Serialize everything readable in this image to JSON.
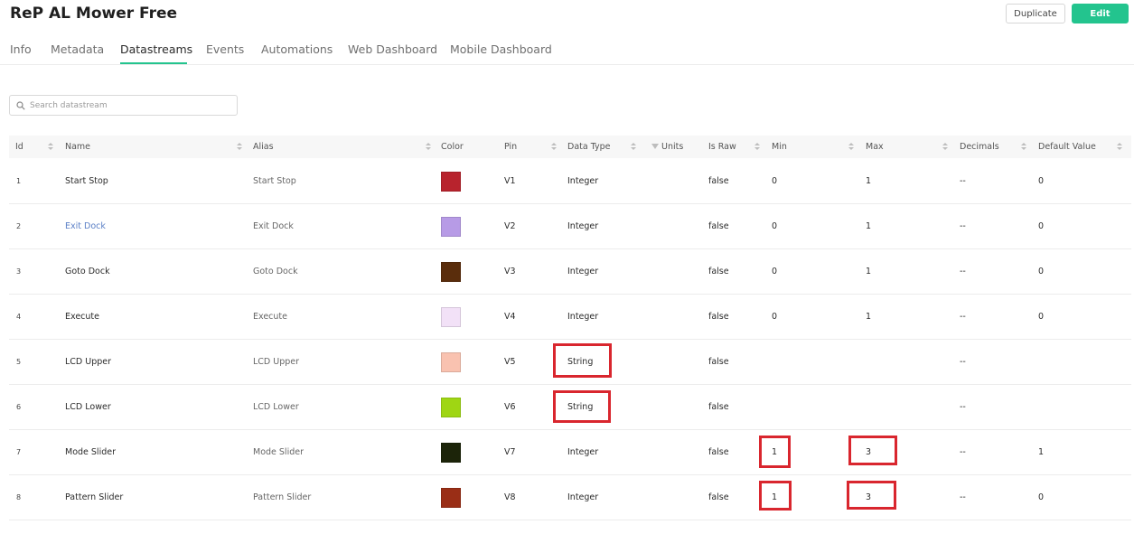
{
  "header": {
    "title": "ReP AL Mower Free",
    "duplicate_label": "Duplicate",
    "edit_label": "Edit"
  },
  "tabs": [
    "Info",
    "Metadata",
    "Datastreams",
    "Events",
    "Automations",
    "Web Dashboard",
    "Mobile Dashboard"
  ],
  "active_tab": "Datastreams",
  "search": {
    "placeholder": "Search datastream",
    "value": ""
  },
  "table": {
    "columns": [
      "Id",
      "Name",
      "Alias",
      "Color",
      "Pin",
      "Data Type",
      "Units",
      "Is Raw",
      "Min",
      "Max",
      "Decimals",
      "Default Value"
    ],
    "rows": [
      {
        "id": "1",
        "name": "Start Stop",
        "alias": "Start Stop",
        "color": "#b8232d",
        "pin": "V1",
        "data_type": "Integer",
        "units": "",
        "is_raw": "false",
        "min": "0",
        "max": "1",
        "decimals": "--",
        "default_value": "0"
      },
      {
        "id": "2",
        "name": "Exit Dock",
        "alias": "Exit Dock",
        "color": "#b79be6",
        "pin": "V2",
        "data_type": "Integer",
        "units": "",
        "is_raw": "false",
        "min": "0",
        "max": "1",
        "decimals": "--",
        "default_value": "0"
      },
      {
        "id": "3",
        "name": "Goto Dock",
        "alias": "Goto Dock",
        "color": "#5a2d0c",
        "pin": "V3",
        "data_type": "Integer",
        "units": "",
        "is_raw": "false",
        "min": "0",
        "max": "1",
        "decimals": "--",
        "default_value": "0"
      },
      {
        "id": "4",
        "name": "Execute",
        "alias": "Execute",
        "color": "#f2e1f7",
        "pin": "V4",
        "data_type": "Integer",
        "units": "",
        "is_raw": "false",
        "min": "0",
        "max": "1",
        "decimals": "--",
        "default_value": "0"
      },
      {
        "id": "5",
        "name": "LCD Upper",
        "alias": "LCD Upper",
        "color": "#f9c2b0",
        "pin": "V5",
        "data_type": "String",
        "units": "",
        "is_raw": "false",
        "min": "",
        "max": "",
        "decimals": "--",
        "default_value": ""
      },
      {
        "id": "6",
        "name": "LCD Lower",
        "alias": "LCD Lower",
        "color": "#9fd613",
        "pin": "V6",
        "data_type": "String",
        "units": "",
        "is_raw": "false",
        "min": "",
        "max": "",
        "decimals": "--",
        "default_value": ""
      },
      {
        "id": "7",
        "name": "Mode Slider",
        "alias": "Mode Slider",
        "color": "#1c2409",
        "pin": "V7",
        "data_type": "Integer",
        "units": "",
        "is_raw": "false",
        "min": "1",
        "max": "3",
        "decimals": "--",
        "default_value": "1"
      },
      {
        "id": "8",
        "name": "Pattern Slider",
        "alias": "Pattern Slider",
        "color": "#9a2e16",
        "pin": "V8",
        "data_type": "Integer",
        "units": "",
        "is_raw": "false",
        "min": "1",
        "max": "3",
        "decimals": "--",
        "default_value": "0"
      }
    ]
  },
  "colors": {
    "accent": "#23c48e",
    "highlight_box": "#d9262e",
    "link": "#5a7fc6"
  }
}
